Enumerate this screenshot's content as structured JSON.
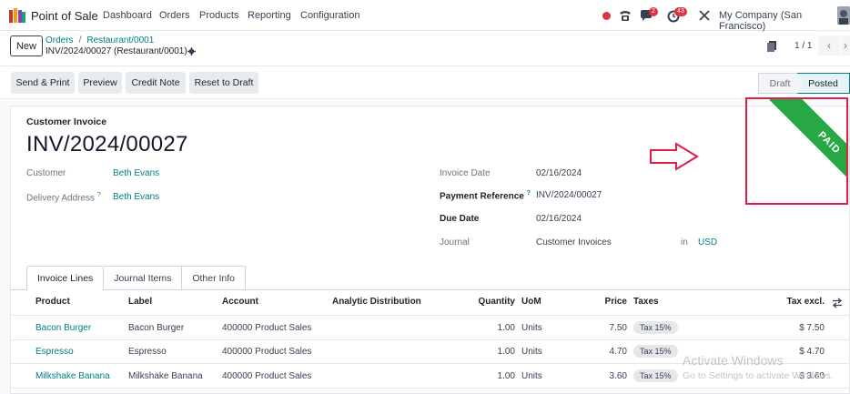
{
  "navbar": {
    "app_name": "Point of Sale",
    "menu": [
      "Dashboard",
      "Orders",
      "Products",
      "Reporting",
      "Configuration"
    ],
    "messages_badge": "2",
    "activities_badge": "43",
    "company": "My Company (San Francisco)"
  },
  "control_panel": {
    "new_label": "New",
    "breadcrumb": [
      "Orders",
      "Restaurant/0001"
    ],
    "breadcrumb_sep": "/",
    "record_name": "INV/2024/00027 (Restaurant/0001)",
    "pager_value": "1 / 1"
  },
  "actions": [
    "Send & Print",
    "Preview",
    "Credit Note",
    "Reset to Draft"
  ],
  "stages": {
    "draft": "Draft",
    "posted": "Posted",
    "current": "Posted"
  },
  "invoice": {
    "doc_type": "Customer Invoice",
    "number": "INV/2024/00027",
    "ribbon": "PAID",
    "fields_left": [
      {
        "label": "Customer",
        "value": "Beth Evans"
      },
      {
        "label": "Delivery Address",
        "value": "Beth Evans"
      }
    ],
    "help_mark": "?",
    "fields_right": [
      {
        "label": "Invoice Date",
        "value": "02/16/2024"
      },
      {
        "label": "Payment Reference",
        "value": "INV/2024/00027"
      },
      {
        "label": "Due Date",
        "value": "02/16/2024"
      },
      {
        "label": "Journal",
        "value": "Customer Invoices"
      }
    ],
    "journal_in": "in",
    "currency": "USD"
  },
  "tabs": [
    "Invoice Lines",
    "Journal Items",
    "Other Info"
  ],
  "lines": {
    "headers": [
      "Product",
      "Label",
      "Account",
      "Analytic Distribution",
      "Quantity",
      "UoM",
      "Price",
      "Taxes",
      "Tax excl."
    ],
    "rows": [
      {
        "product": "Bacon Burger",
        "label": "Bacon Burger",
        "account": "400000 Product Sales",
        "quantity": "1.00",
        "uom": "Units",
        "price": "7.50",
        "tax": "Tax 15%",
        "subtotal": "$ 7.50"
      },
      {
        "product": "Espresso",
        "label": "Espresso",
        "account": "400000 Product Sales",
        "quantity": "1.00",
        "uom": "Units",
        "price": "4.70",
        "tax": "Tax 15%",
        "subtotal": "$ 4.70"
      },
      {
        "product": "Milkshake Banana",
        "label": "Milkshake Banana",
        "account": "400000 Product Sales",
        "quantity": "1.00",
        "uom": "Units",
        "price": "3.60",
        "tax": "Tax 15%",
        "subtotal": "$ 3.60"
      }
    ]
  },
  "watermark": {
    "title": "Activate Windows",
    "subtitle": "Go to Settings to activate Windows."
  },
  "colors": {
    "brand": "#017e84",
    "paid": "#28a745",
    "highlight": "#e11d48"
  }
}
